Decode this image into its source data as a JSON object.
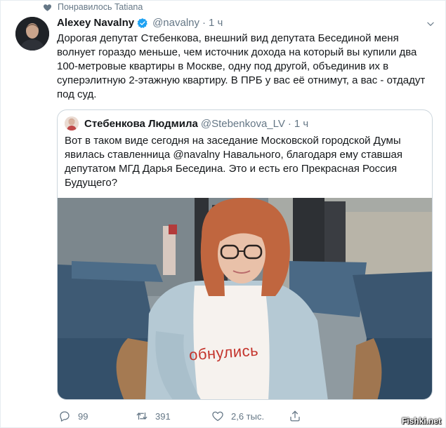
{
  "social_context": {
    "text": "Понравилось Tatiana",
    "icon": "heart-icon"
  },
  "tweet": {
    "author_name": "Alexey Navalny",
    "author_handle": "@navalny",
    "separator": "·",
    "time": "1 ч",
    "verified": true,
    "text": "Дорогая депутат Стебенкова, внешний вид депутата Бесединой меня волнует гораздо меньше, чем источник дохода на который вы купили два 100-метровые квартиры в Москве, одну под другой, объединив их в суперэлитную 2-этажную квартиру. В ПРБ у вас её отнимут, а вас - отдадут под суд."
  },
  "quoted_tweet": {
    "author_name": "Стебенкова Людмила",
    "author_handle": "@Stebenkova_LV",
    "separator": "·",
    "time": "1 ч",
    "text": "Вот в таком виде сегодня на заседание Московской городской Думы явилась ставленница @navalny Навального, благодаря ему ставшая депутатом МГД Дарья Беседина. Это и есть его Прекрасная Россия Будущего?",
    "media": {
      "shirt_text": "обнулись"
    }
  },
  "actions": {
    "reply_count": "99",
    "retweet_count": "391",
    "like_count": "2,6 тыс."
  },
  "watermark": "Fishki.net",
  "colors": {
    "text_primary": "#14171a",
    "text_secondary": "#657786",
    "verified_blue": "#1da1f2",
    "border": "#ccd6dd",
    "shirt_text_red": "#c4342c"
  }
}
